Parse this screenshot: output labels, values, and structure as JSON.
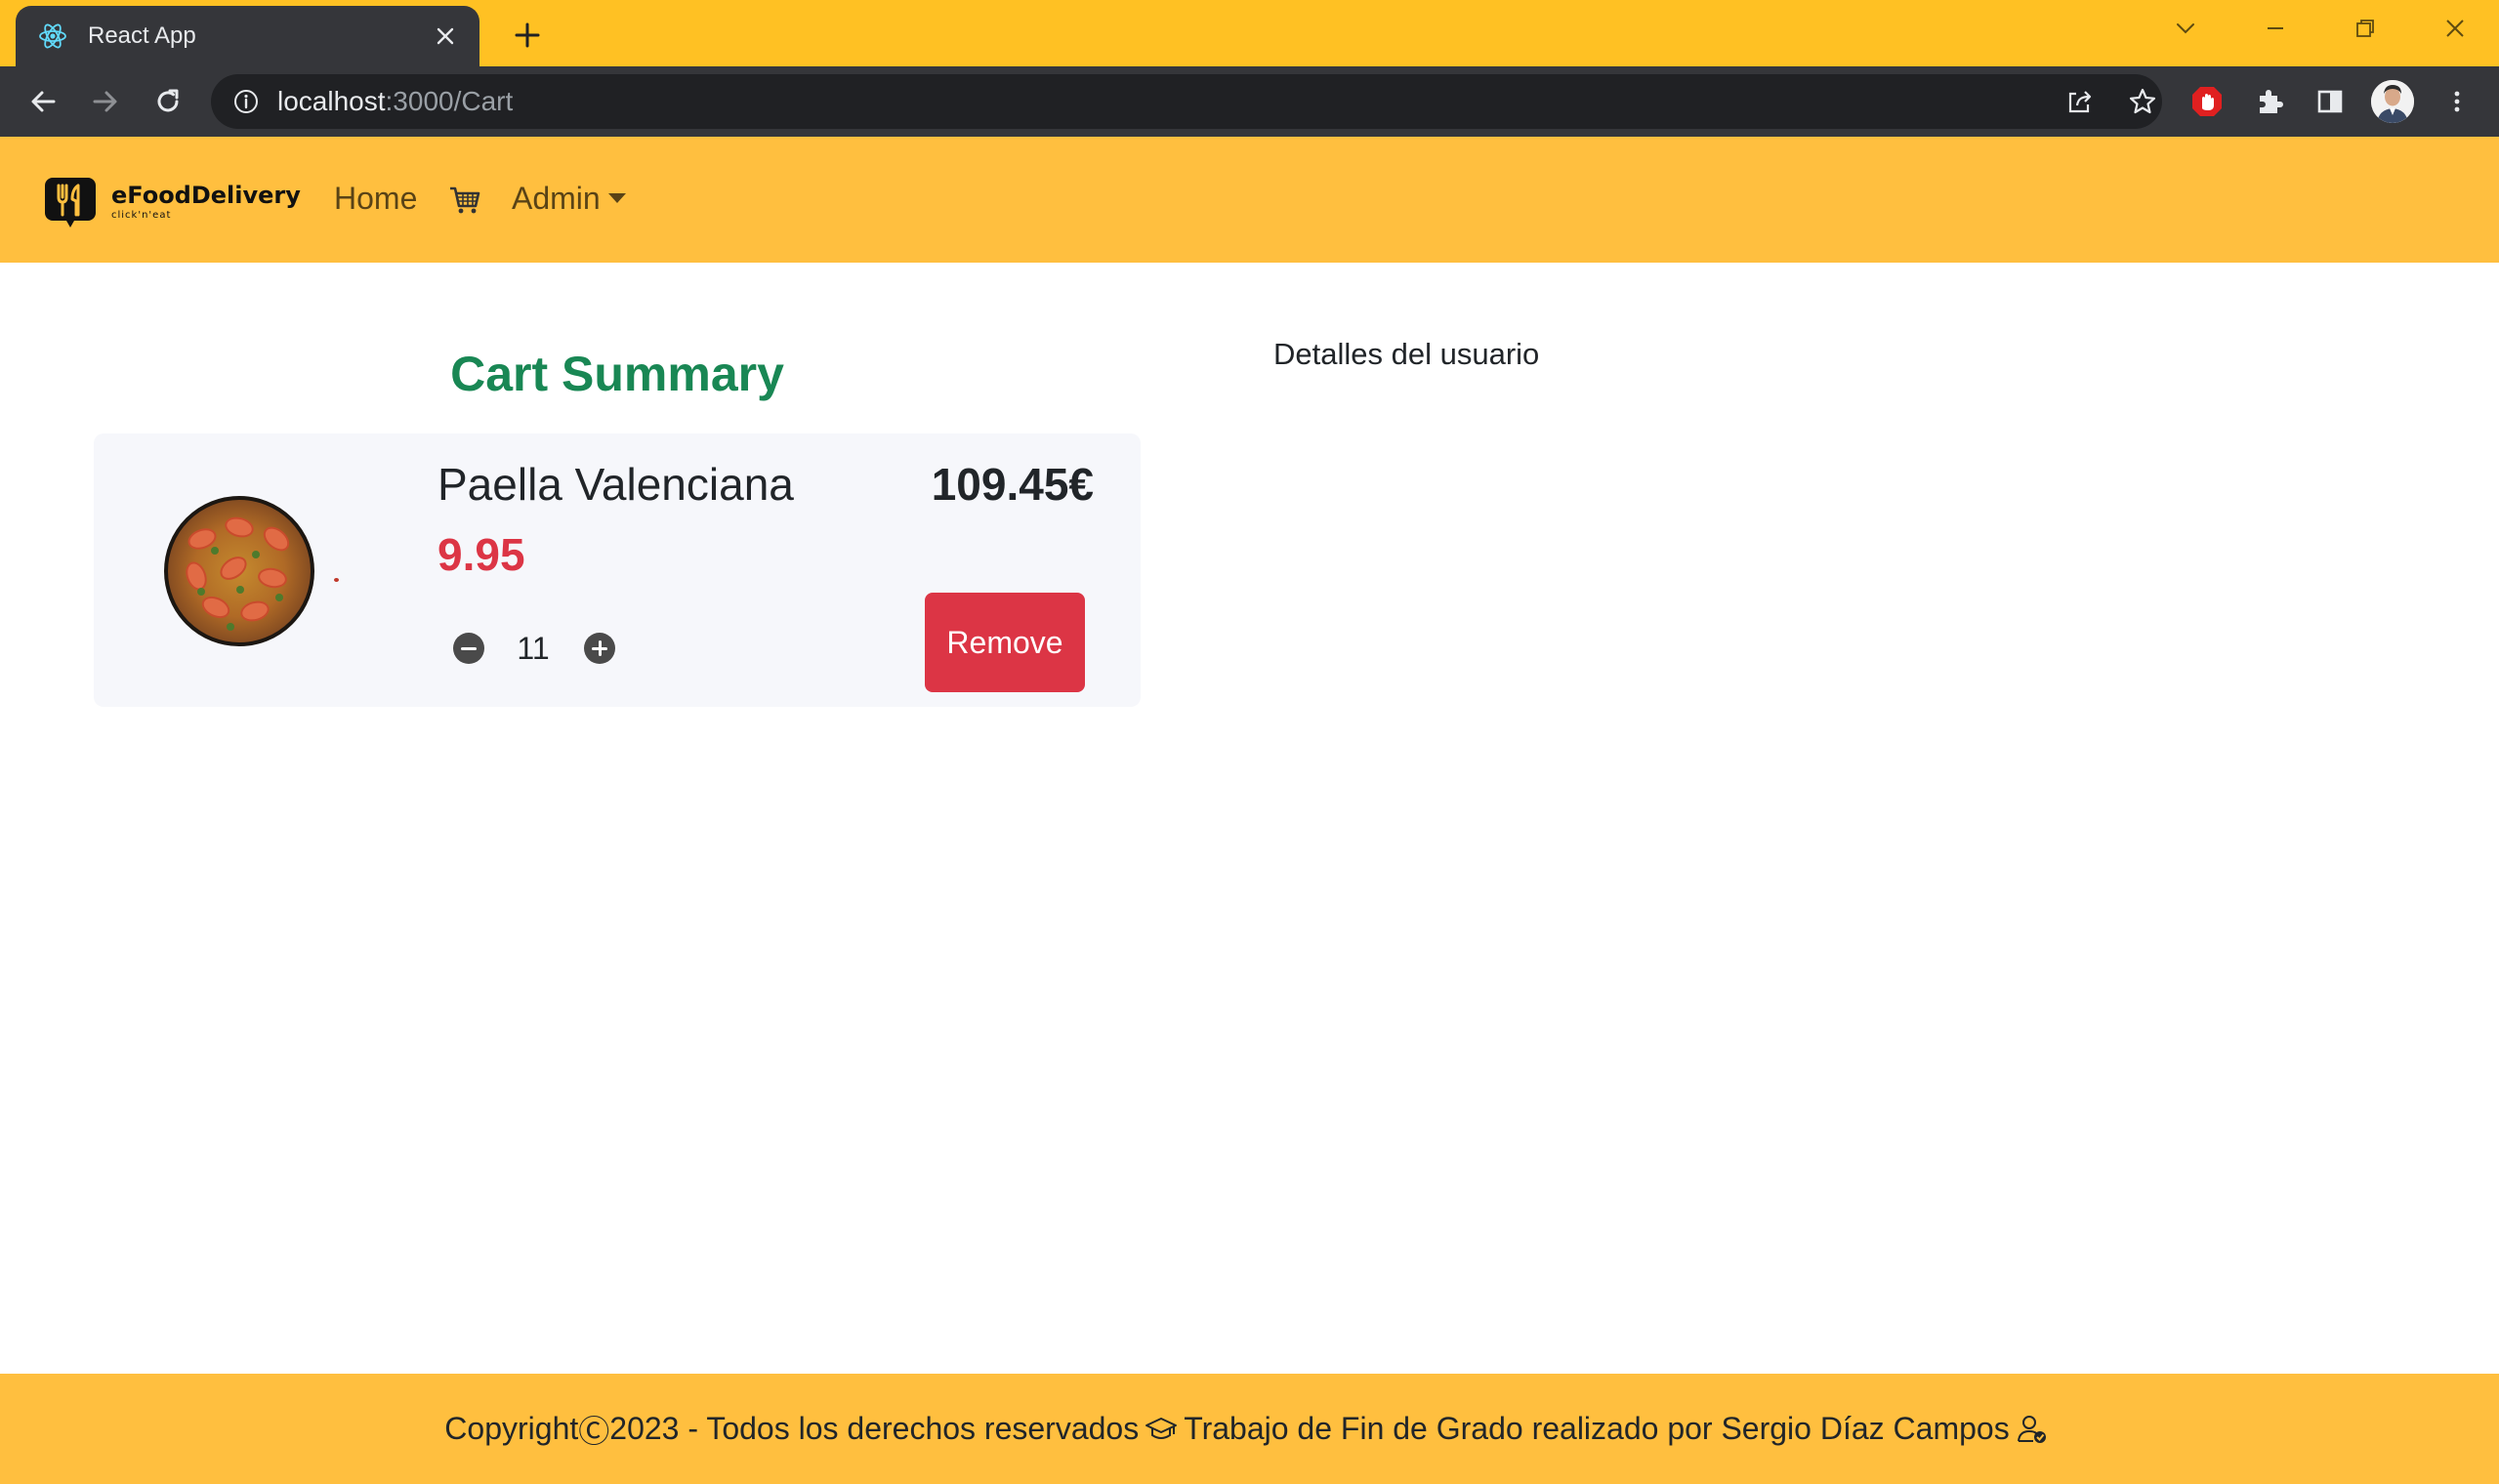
{
  "browser": {
    "tab_title": "React App",
    "url_host": "localhost",
    "url_path": ":3000/Cart"
  },
  "navbar": {
    "brand_name": "eFoodDelivery",
    "brand_tagline": "click'n'eat",
    "links": {
      "home": "Home",
      "admin": "Admin"
    }
  },
  "cart": {
    "title": "Cart Summary",
    "items": [
      {
        "name": "Paella Valenciana",
        "price": "9.95",
        "quantity": "11",
        "total": "109.45€",
        "remove_label": "Remove"
      }
    ]
  },
  "user_details": {
    "heading": "Detalles del usuario"
  },
  "footer": {
    "text_part1": "Copyright",
    "copyright_symbol": "Ⓒ",
    "text_part2": "2023 - Todos los derechos reservados",
    "text_part3": "Trabajo de Fin de Grado realizado por Sergio Díaz Campos"
  },
  "colors": {
    "chrome_frame": "#ffc123",
    "chrome_toolbar": "#35363a",
    "navbar_bg": "#ffbf3f",
    "title_green": "#198754",
    "danger_red": "#dc3545"
  },
  "icons": {
    "tab_favicon": "react-icon",
    "cart": "shopping-cart-icon",
    "footer_left": "graduation-cap-icon",
    "footer_right": "user-check-icon"
  }
}
